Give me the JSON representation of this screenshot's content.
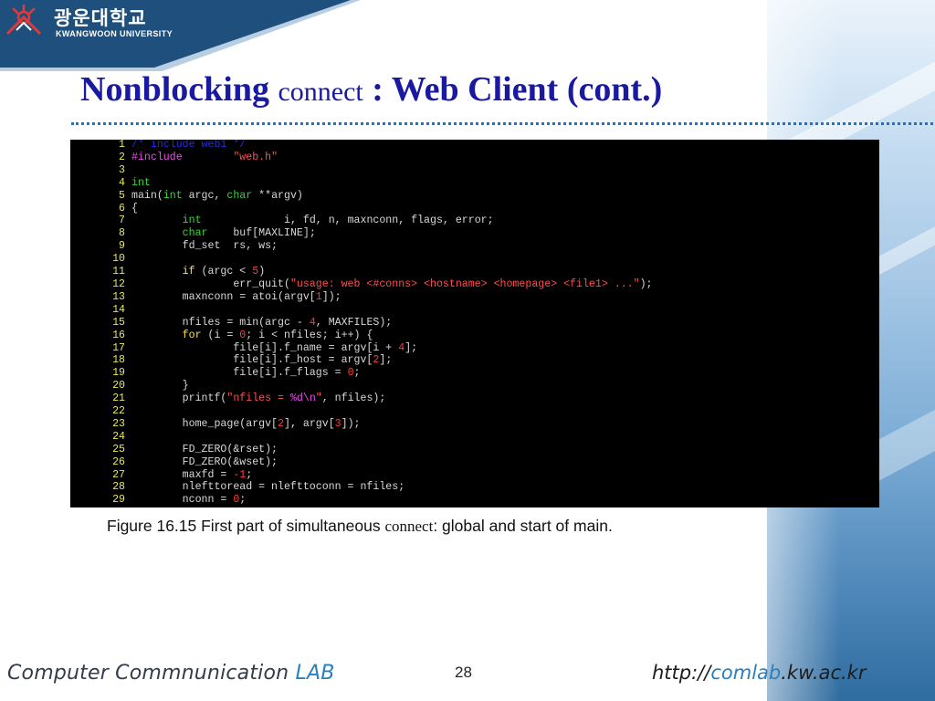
{
  "header": {
    "logo_korean": "광운대학교",
    "logo_english": "KWANGWOON UNIVERSITY"
  },
  "title": {
    "part1": "Nonblocking",
    "part2": "connect",
    "part3": ": Web Client (cont.)"
  },
  "code_lines": [
    {
      "n": "1",
      "tokens": [
        {
          "t": "/* include web1 */",
          "c": "cm"
        }
      ]
    },
    {
      "n": "2",
      "tokens": [
        {
          "t": "#include        ",
          "c": "pp"
        },
        {
          "t": "\"web.h\"",
          "c": "str"
        }
      ]
    },
    {
      "n": "3",
      "tokens": []
    },
    {
      "n": "4",
      "tokens": [
        {
          "t": "int",
          "c": "ty"
        }
      ]
    },
    {
      "n": "5",
      "tokens": [
        {
          "t": "main(",
          "c": ""
        },
        {
          "t": "int",
          "c": "ty"
        },
        {
          "t": " argc, ",
          "c": ""
        },
        {
          "t": "char",
          "c": "ty"
        },
        {
          "t": " **argv)",
          "c": ""
        }
      ]
    },
    {
      "n": "6",
      "tokens": [
        {
          "t": "{",
          "c": ""
        }
      ]
    },
    {
      "n": "7",
      "tokens": [
        {
          "t": "        ",
          "c": ""
        },
        {
          "t": "int",
          "c": "ty"
        },
        {
          "t": "             i, fd, n, maxnconn, flags, error;",
          "c": ""
        }
      ]
    },
    {
      "n": "8",
      "tokens": [
        {
          "t": "        ",
          "c": ""
        },
        {
          "t": "char",
          "c": "ty"
        },
        {
          "t": "    buf[MAXLINE];",
          "c": ""
        }
      ]
    },
    {
      "n": "9",
      "tokens": [
        {
          "t": "        fd_set  rs, ws;",
          "c": ""
        }
      ]
    },
    {
      "n": "10",
      "tokens": []
    },
    {
      "n": "11",
      "tokens": [
        {
          "t": "        ",
          "c": ""
        },
        {
          "t": "if",
          "c": "kw"
        },
        {
          "t": " (argc < ",
          "c": ""
        },
        {
          "t": "5",
          "c": "num"
        },
        {
          "t": ")",
          "c": ""
        }
      ]
    },
    {
      "n": "12",
      "tokens": [
        {
          "t": "                err_quit(",
          "c": ""
        },
        {
          "t": "\"usage: web <#conns> <hostname> <homepage> <file1> ...\"",
          "c": "str"
        },
        {
          "t": ");",
          "c": ""
        }
      ]
    },
    {
      "n": "13",
      "tokens": [
        {
          "t": "        maxnconn = atoi(argv[",
          "c": ""
        },
        {
          "t": "1",
          "c": "num"
        },
        {
          "t": "]);",
          "c": ""
        }
      ]
    },
    {
      "n": "14",
      "tokens": []
    },
    {
      "n": "15",
      "tokens": [
        {
          "t": "        nfiles = min(argc - ",
          "c": ""
        },
        {
          "t": "4",
          "c": "num"
        },
        {
          "t": ", MAXFILES);",
          "c": ""
        }
      ]
    },
    {
      "n": "16",
      "tokens": [
        {
          "t": "        ",
          "c": ""
        },
        {
          "t": "for",
          "c": "kw"
        },
        {
          "t": " (i = ",
          "c": ""
        },
        {
          "t": "0",
          "c": "num"
        },
        {
          "t": "; i < nfiles; i++) {",
          "c": ""
        }
      ]
    },
    {
      "n": "17",
      "tokens": [
        {
          "t": "                file[i].f_name = argv[i + ",
          "c": ""
        },
        {
          "t": "4",
          "c": "num"
        },
        {
          "t": "];",
          "c": ""
        }
      ]
    },
    {
      "n": "18",
      "tokens": [
        {
          "t": "                file[i].f_host = argv[",
          "c": ""
        },
        {
          "t": "2",
          "c": "num"
        },
        {
          "t": "];",
          "c": ""
        }
      ]
    },
    {
      "n": "19",
      "tokens": [
        {
          "t": "                file[i].f_flags = ",
          "c": ""
        },
        {
          "t": "0",
          "c": "num"
        },
        {
          "t": ";",
          "c": ""
        }
      ]
    },
    {
      "n": "20",
      "tokens": [
        {
          "t": "        }",
          "c": ""
        }
      ]
    },
    {
      "n": "21",
      "tokens": [
        {
          "t": "        printf(",
          "c": ""
        },
        {
          "t": "\"nfiles = ",
          "c": "str"
        },
        {
          "t": "%d\\n",
          "c": "pp"
        },
        {
          "t": "\"",
          "c": "str"
        },
        {
          "t": ", nfiles);",
          "c": ""
        }
      ]
    },
    {
      "n": "22",
      "tokens": []
    },
    {
      "n": "23",
      "tokens": [
        {
          "t": "        home_page(argv[",
          "c": ""
        },
        {
          "t": "2",
          "c": "num"
        },
        {
          "t": "], argv[",
          "c": ""
        },
        {
          "t": "3",
          "c": "num"
        },
        {
          "t": "]);",
          "c": ""
        }
      ]
    },
    {
      "n": "24",
      "tokens": []
    },
    {
      "n": "25",
      "tokens": [
        {
          "t": "        FD_ZERO(&rset);",
          "c": ""
        }
      ]
    },
    {
      "n": "26",
      "tokens": [
        {
          "t": "        FD_ZERO(&wset);",
          "c": ""
        }
      ]
    },
    {
      "n": "27",
      "tokens": [
        {
          "t": "        maxfd = ",
          "c": ""
        },
        {
          "t": "-1",
          "c": "num"
        },
        {
          "t": ";",
          "c": ""
        }
      ]
    },
    {
      "n": "28",
      "tokens": [
        {
          "t": "        nlefttoread = nlefttoconn = nfiles;",
          "c": ""
        }
      ]
    },
    {
      "n": "29",
      "tokens": [
        {
          "t": "        nconn = ",
          "c": ""
        },
        {
          "t": "0",
          "c": "num"
        },
        {
          "t": ";",
          "c": ""
        }
      ]
    }
  ],
  "caption": {
    "prefix": "Figure 16.15 First part of simultaneous ",
    "mono": "connect",
    "suffix": ": global and start of main."
  },
  "footer": {
    "lab_part1": "Computer Commnunication ",
    "lab_part2": "LAB",
    "page_number": "28",
    "url_part1": "http://",
    "url_part2": "comlab",
    "url_part3": ".kw.ac.kr"
  }
}
